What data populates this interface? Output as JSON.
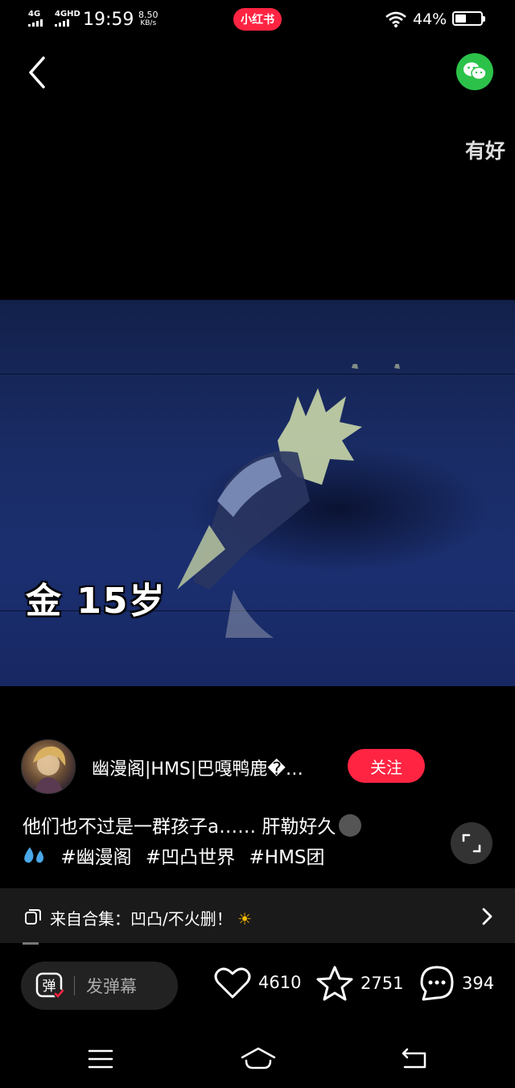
{
  "status_bar": {
    "signal_1": "4G",
    "signal_2": "4GHD",
    "time": "19:59",
    "net_speed_value": "8.50",
    "net_speed_unit": "KB/s",
    "app_badge": "小红书",
    "battery_percent": "44%",
    "battery_level": 0.44
  },
  "video": {
    "floating_danmaku": "有好",
    "subtitle": "金 15岁"
  },
  "author": {
    "name": "幽漫阁|HMS|巴嘎鸭鹿�…",
    "follow_label": "关注"
  },
  "caption": {
    "line1": "他们也不过是一群孩子a…… 肝勒好久",
    "tags": [
      "#幽漫阁",
      "#凹凸世界",
      "#HMS团"
    ]
  },
  "collection": {
    "label": "来自合集：凹凸/不火删！"
  },
  "actions": {
    "danmaku_placeholder": "发弹幕",
    "danmaku_icon_char": "弹",
    "likes": "4610",
    "favorites": "2751",
    "comments": "394"
  },
  "colors": {
    "accent": "#ff2442",
    "wechat": "#2cc24a",
    "background": "#000000"
  },
  "icons": {
    "back": "chevron-left-icon",
    "share": "wechat-icon",
    "fullscreen": "expand-icon",
    "like": "heart-icon",
    "favorite": "star-icon",
    "comment": "comment-icon"
  }
}
